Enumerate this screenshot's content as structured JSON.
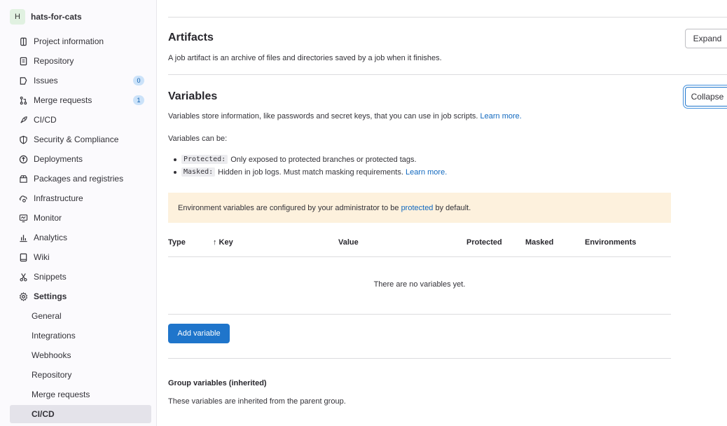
{
  "sidebar": {
    "avatar_letter": "H",
    "project_name": "hats-for-cats",
    "items": [
      {
        "label": "Project information",
        "icon": "project-info-icon"
      },
      {
        "label": "Repository",
        "icon": "repository-icon"
      },
      {
        "label": "Issues",
        "icon": "issues-icon",
        "badge": "0"
      },
      {
        "label": "Merge requests",
        "icon": "merge-request-icon",
        "badge": "1"
      },
      {
        "label": "CI/CD",
        "icon": "rocket-icon"
      },
      {
        "label": "Security & Compliance",
        "icon": "shield-icon"
      },
      {
        "label": "Deployments",
        "icon": "deployments-icon"
      },
      {
        "label": "Packages and registries",
        "icon": "package-icon"
      },
      {
        "label": "Infrastructure",
        "icon": "cloud-gear-icon"
      },
      {
        "label": "Monitor",
        "icon": "monitor-icon"
      },
      {
        "label": "Analytics",
        "icon": "chart-icon"
      },
      {
        "label": "Wiki",
        "icon": "book-icon"
      },
      {
        "label": "Snippets",
        "icon": "scissors-icon"
      },
      {
        "label": "Settings",
        "icon": "settings-icon"
      }
    ],
    "settings_subitems": [
      "General",
      "Integrations",
      "Webhooks",
      "Repository",
      "Merge requests",
      "CI/CD"
    ]
  },
  "artifacts": {
    "title": "Artifacts",
    "description": "A job artifact is an archive of files and directories saved by a job when it finishes.",
    "expand_label": "Expand"
  },
  "variables": {
    "title": "Variables",
    "description": "Variables store information, like passwords and secret keys, that you can use in job scripts.",
    "learn_more": "Learn more.",
    "collapse_label": "Collapse",
    "can_be": "Variables can be:",
    "protected_code": "Protected:",
    "protected_text": "Only exposed to protected branches or protected tags.",
    "masked_code": "Masked:",
    "masked_text": "Hidden in job logs. Must match masking requirements.",
    "masked_learn_more": "Learn more.",
    "alert_prefix": "Environment variables are configured by your administrator to be",
    "alert_link": "protected",
    "alert_suffix": "by default.",
    "table": {
      "columns": [
        "Type",
        "↑ Key",
        "Value",
        "Protected",
        "Masked",
        "Environments"
      ],
      "empty_text": "There are no variables yet."
    },
    "add_button": "Add variable"
  },
  "group_variables": {
    "title": "Group variables (inherited)",
    "description": "These variables are inherited from the parent group."
  },
  "colors": {
    "primary": "#1f75cb",
    "link": "#1068bf",
    "alert_bg": "#fdf1dd",
    "badge_bg": "#cbe2f9"
  }
}
